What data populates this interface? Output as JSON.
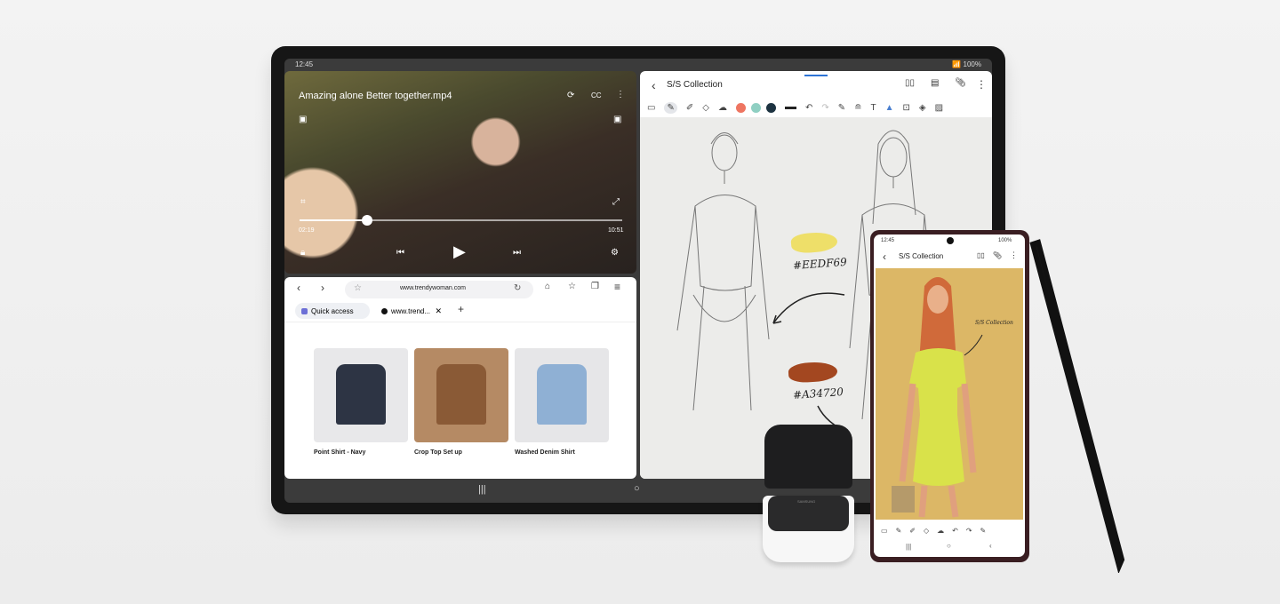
{
  "tablet": {
    "status": {
      "time": "12:45",
      "battery": "100%"
    },
    "video": {
      "title": "Amazing alone Better together.mp4",
      "cc_label": "CC",
      "elapsed": "02:19",
      "duration": "10:51",
      "progress_percent": 21
    },
    "browser": {
      "url": "www.trendywoman.com",
      "tabs": [
        {
          "label": "Quick access"
        },
        {
          "label": "www.trend..."
        }
      ],
      "products": [
        {
          "name": "Point Shirt - Navy",
          "color": "#2d3444",
          "bg": "#e8e8ea"
        },
        {
          "name": "Crop Top Set up",
          "color": "#8a5a36",
          "bg": "#b58a64"
        },
        {
          "name": "Washed Denim Shirt",
          "color": "#8fb0d4",
          "bg": "#e6e6e8"
        }
      ]
    },
    "notes": {
      "title": "S/S Collection",
      "pen_colors": [
        "#ee7561",
        "#8fcfc2",
        "#1d3341"
      ],
      "swatches": [
        {
          "label": "#EEDF69",
          "color": "#EEDF69"
        },
        {
          "label": "#A34720",
          "color": "#A34720"
        }
      ]
    }
  },
  "phone": {
    "time": "12:45",
    "battery": "100%",
    "notes_title": "S/S Collection",
    "annotation": "S/S Collection",
    "paper_color": "#dcb766",
    "dress_color": "#d9e24a"
  },
  "earbuds": {
    "brand": "SAMSUNG"
  }
}
